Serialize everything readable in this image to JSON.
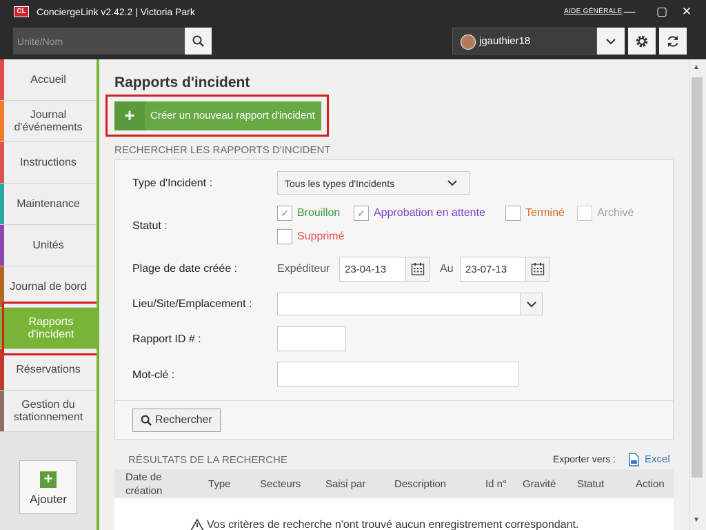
{
  "titlebar": {
    "logo": "CL",
    "title": "ConciergeLink v2.42.2 | Victoria Park",
    "help_link": "AIDE GÉNÉRALE",
    "minimize": "—",
    "maximize": "▢",
    "close": "✕"
  },
  "search": {
    "placeholder": "Unité/Nom"
  },
  "user": {
    "name": "jgauthier18"
  },
  "sidebar": {
    "items": [
      {
        "label": "Accueil",
        "color": "#e04b4b"
      },
      {
        "label": "Journal d'événements",
        "color": "#f07a2a"
      },
      {
        "label": "Instructions",
        "color": "#d9534f"
      },
      {
        "label": "Maintenance",
        "color": "#2aa7a0"
      },
      {
        "label": "Unités",
        "color": "#8e44ad"
      },
      {
        "label": "Journal de bord",
        "color": "#b5651d"
      },
      {
        "label": "Rapports d'incident",
        "color": "#79b437"
      },
      {
        "label": "Réservations",
        "color": "#c0392b"
      },
      {
        "label": "Gestion du stationnement",
        "color": "#8d6e63"
      }
    ],
    "add_label": "Ajouter"
  },
  "main": {
    "title": "Rapports d'incident",
    "create_label": "Créer un nouveau rapport d'incident",
    "search_section_title": "RECHERCHER LES RAPPORTS D'INCIDENT",
    "form": {
      "type_label": "Type d'Incident :",
      "type_value": "Tous les types d'Incidents",
      "status_label": "Statut :",
      "statuses": [
        {
          "label": "Brouillon",
          "checked": true,
          "color": "#3a9a3a"
        },
        {
          "label": "Approbation en attente",
          "checked": true,
          "color": "#7b3fc4"
        },
        {
          "label": "Terminé",
          "checked": false,
          "color": "#d2691e"
        },
        {
          "label": "Archivé",
          "checked": false,
          "color": "#9e9e9e"
        },
        {
          "label": "Supprimé",
          "checked": false,
          "color": "#e05050"
        }
      ],
      "date_label": "Plage de date créée :",
      "from_label": "Expéditeur",
      "from_value": "23-04-13",
      "to_label": "Au",
      "to_value": "23-07-13",
      "location_label": "Lieu/Site/Emplacement :",
      "location_value": "",
      "report_id_label": "Rapport ID # :",
      "report_id_value": "",
      "keyword_label": "Mot-clé :",
      "keyword_value": "",
      "search_button": "Rechercher"
    },
    "results": {
      "title": "RÉSULTATS DE LA RECHERCHE",
      "export_label": "Exporter vers :",
      "excel_label": "Excel",
      "columns": [
        "Date de création",
        "Type",
        "Secteurs",
        "Saisi par",
        "Description",
        "Id n°",
        "Gravité",
        "Statut",
        "Action"
      ],
      "empty_message": "Vos critères de recherche n'ont trouvé aucun enregistrement correspondant."
    }
  }
}
